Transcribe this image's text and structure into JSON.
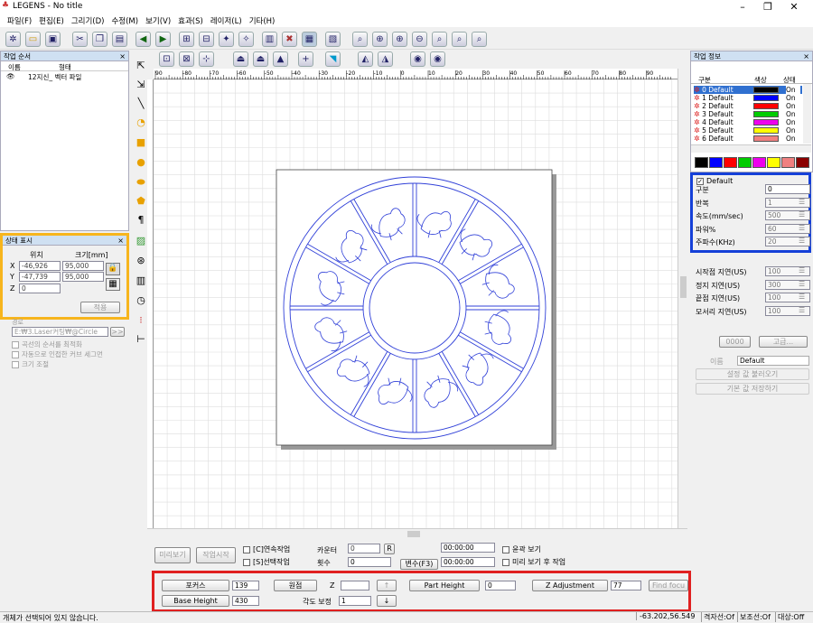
{
  "app": {
    "title": "LEGENS - No title"
  },
  "menu": [
    "파일(F)",
    "편집(E)",
    "그리기(D)",
    "수정(M)",
    "보기(V)",
    "효과(S)",
    "레이저(L)",
    "기타(H)"
  ],
  "work_order": {
    "title": "작업 순서",
    "col_name": "이름",
    "col_type": "형태",
    "item": "12지신_ 벡터 파일"
  },
  "status_panel": {
    "title": "상태 표시",
    "pos_label": "위치",
    "size_label": "크기[mm]",
    "x_label": "X",
    "y_label": "Y",
    "z_label": "Z",
    "x_pos": "-46,926",
    "x_size": "95,000",
    "y_pos": "-47,739",
    "y_size": "95,000",
    "z_val": "0",
    "apply": "적용"
  },
  "lower_left": {
    "path_label": "경로",
    "path": "E:₩3.Laser커팅₩@Circle",
    "path_btn": ">>",
    "opt1": "곡선의 순서를 최적화",
    "opt2": "자동으로 인접한 커브 세그먼",
    "opt3": "크기 조절"
  },
  "ruler": {
    "ticks": [
      "90",
      "-80",
      "-70",
      "-60",
      "-50",
      "-40",
      "-30",
      "-20",
      "-10",
      "0",
      "10",
      "20",
      "30",
      "40",
      "50",
      "60",
      "70",
      "80",
      "90"
    ]
  },
  "bottom": {
    "preview": "미리보기",
    "start": "작업시작",
    "continuous": "[C]연속작업",
    "selected": "[S]선택작업",
    "counter_label": "카운터",
    "counter_val": "0",
    "r_btn": "R",
    "count_label": "횟수",
    "count_val": "0",
    "time1": "00:00:00",
    "time2": "00:00:00",
    "var_btn": "변수(F3)",
    "outline": "윤곽 보기",
    "after_preview": "미리 보기 후 작업"
  },
  "control": {
    "focus": "포커스",
    "focus_val": "139",
    "origin": "원점",
    "z_label": "Z",
    "part_height": "Part Height",
    "part_height_val": "0",
    "z_adj": "Z Adjustment",
    "z_adj_val": "77",
    "find_focus": "Find focu",
    "base_height": "Base Height",
    "base_height_val": "430",
    "angle_label": "각도 보정",
    "angle_val": "1"
  },
  "layer_panel": {
    "title": "작업 정보",
    "col_div": "구분",
    "col_color": "색상",
    "col_state": "상태",
    "layers": [
      {
        "name": "0 Default",
        "color": "#000000",
        "state": "On"
      },
      {
        "name": "1 Default",
        "color": "#0000ff",
        "state": "On"
      },
      {
        "name": "2 Default",
        "color": "#ff0000",
        "state": "On"
      },
      {
        "name": "3 Default",
        "color": "#00cc00",
        "state": "On"
      },
      {
        "name": "4 Default",
        "color": "#ee00ee",
        "state": "On"
      },
      {
        "name": "5 Default",
        "color": "#ffff00",
        "state": "On"
      },
      {
        "name": "6 Default",
        "color": "#f08080",
        "state": "On"
      }
    ],
    "palette": [
      "#000000",
      "#0000ff",
      "#ff0000",
      "#00cc00",
      "#ee00ee",
      "#ffff00",
      "#f08080",
      "#8b0000"
    ]
  },
  "props": {
    "header": "Default",
    "rows": [
      {
        "label": "구분",
        "val": "0"
      },
      {
        "label": "반복",
        "val": "1"
      },
      {
        "label": "속도(mm/sec)",
        "val": "500"
      },
      {
        "label": "파워%",
        "val": "60"
      },
      {
        "label": "주파수(KHz)",
        "val": "20"
      }
    ],
    "delays": [
      {
        "label": "시작점 지연(US)",
        "val": "100"
      },
      {
        "label": "정지 지연(US)",
        "val": "300"
      },
      {
        "label": "끝점 지연(US)",
        "val": "100"
      },
      {
        "label": "모서리 지연(US)",
        "val": "100"
      }
    ],
    "btn1": "0000",
    "btn2": "고급...",
    "name_label": "이름",
    "name_val": "Default",
    "load_btn": "설정 값 불러오기",
    "save_btn": "기본 값 저장하기"
  },
  "statusbar": {
    "msg": "개체가 선택되어 있지 않습니다.",
    "coords": "-63.202,56.549",
    "grid": "격자선:Of",
    "aux": "보조선:Of",
    "snap": "대상:Off"
  }
}
